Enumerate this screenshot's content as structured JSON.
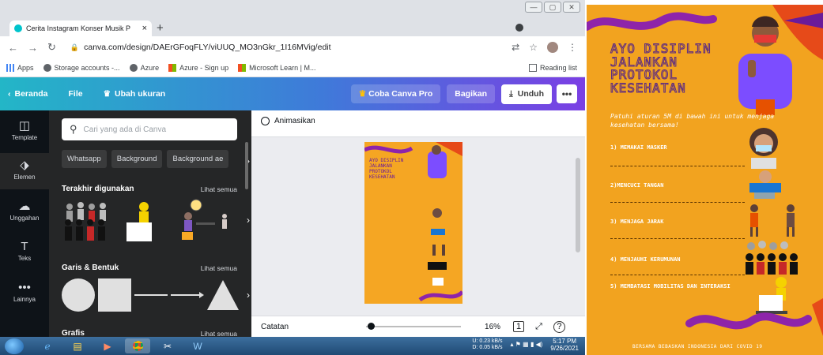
{
  "browser": {
    "tab_title": "Cerita Instagram Konser Musik P",
    "new_tab": "+",
    "url": "canva.com/design/DAErGFoqFLY/viUUQ_MO3nGkr_1I16MVig/edit",
    "bookmarks": [
      {
        "label": "Apps",
        "icon": "apps-grid-icon"
      },
      {
        "label": "Storage accounts -...",
        "icon": "globe-icon"
      },
      {
        "label": "Azure",
        "icon": "globe-icon"
      },
      {
        "label": "Azure - Sign up",
        "icon": "microsoft-icon"
      },
      {
        "label": "Microsoft Learn | M...",
        "icon": "microsoft-icon"
      }
    ],
    "reading_list": "Reading list"
  },
  "canva": {
    "toolbar": {
      "home": "Beranda",
      "file": "File",
      "resize": "Ubah ukuran",
      "try_pro": "Coba Canva Pro",
      "share": "Bagikan",
      "download": "Unduh",
      "more": "•••"
    },
    "rail": [
      {
        "label": "Template",
        "glyph": "◫"
      },
      {
        "label": "Elemen",
        "glyph": "⬗"
      },
      {
        "label": "Unggahan",
        "glyph": "☁"
      },
      {
        "label": "Teks",
        "glyph": "T"
      },
      {
        "label": "Lainnya",
        "glyph": "•••"
      }
    ],
    "search_placeholder": "Cari yang ada di Canva",
    "chips": [
      "Whatsapp",
      "Background",
      "Background ae"
    ],
    "sections": {
      "recent": {
        "title": "Terakhir digunakan",
        "link": "Lihat semua"
      },
      "shapes": {
        "title": "Garis & Bentuk",
        "link": "Lihat semua"
      },
      "graphics": {
        "title": "Grafis",
        "link": "Lihat semua"
      }
    },
    "animate": "Animasikan",
    "notes": "Catatan",
    "zoom": "16%",
    "page_indicator": "1",
    "zoom_fraction": 0.02
  },
  "taskbar": {
    "net_up": "U:   0.23 kB/s",
    "net_down": "D:   0.05 kB/s",
    "time": "5:17 PM",
    "date": "9/26/2021"
  },
  "poster": {
    "title_lines": [
      "AYO DISIPLIN",
      "JALANKAN",
      "PROTOKOL",
      "KESEHATAN"
    ],
    "subtitle": "Patuhi aturan 5M di bawah ini untuk menjaga kesehatan bersama!",
    "items": [
      "1) MEMAKAI MASKER",
      "2)MENCUCI TANGAN",
      "3) MENJAGA JARAK",
      "4) MENJAUHI KERUMUNAN",
      "5) MEMBATASI MOBILITAS DAN INTERAKSI"
    ],
    "footer": "BERSAMA BEBASKAN INDONESIA DARI COVID 19",
    "colors": {
      "background": "#f2a31f",
      "accent": "#8e44ad",
      "title_stroke": "#5b2a86"
    }
  }
}
